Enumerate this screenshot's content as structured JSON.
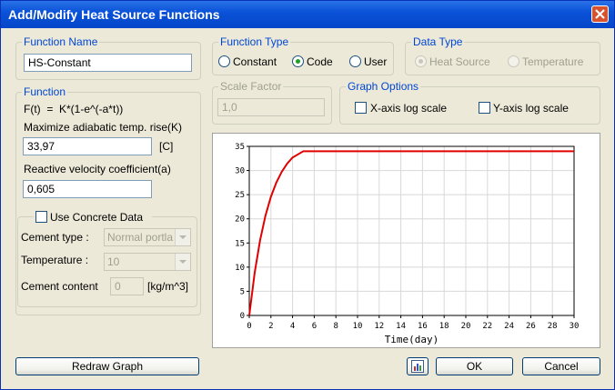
{
  "window": {
    "title": "Add/Modify Heat Source Functions"
  },
  "function_name": {
    "label": "Function Name",
    "value": "HS-Constant"
  },
  "function": {
    "label": "Function",
    "formula": "F(t)  =  K*(1-e^(-a*t))",
    "max_temp_label": "Maximize adiabatic temp. rise(K)",
    "max_temp_value": "33,97",
    "max_temp_unit": "[C]",
    "velocity_label": "Reactive velocity coefficient(a)",
    "velocity_value": "0,605"
  },
  "concrete": {
    "use_label": "Use Concrete Data",
    "use_checked": false,
    "cement_type_label": "Cement type :",
    "cement_type_value": "Normal portla",
    "temperature_label": "Temperature :",
    "temperature_value": "10",
    "cement_content_label": "Cement content",
    "cement_content_value": "0",
    "cement_content_unit": "[kg/m^3]"
  },
  "function_type": {
    "label": "Function Type",
    "options": [
      "Constant",
      "Code",
      "User"
    ],
    "selected": "Code"
  },
  "data_type": {
    "label": "Data Type",
    "options": [
      "Heat Source",
      "Temperature"
    ],
    "selected": "Heat Source"
  },
  "scale_factor": {
    "label": "Scale Factor",
    "value": "1,0"
  },
  "graph_options": {
    "label": "Graph Options",
    "x_log_label": "X-axis log scale",
    "y_log_label": "Y-axis log scale",
    "x_log": false,
    "y_log": false
  },
  "buttons": {
    "redraw": "Redraw Graph",
    "ok": "OK",
    "cancel": "Cancel"
  },
  "colors": {
    "accent": "#0046d5",
    "curve": "#e00000",
    "title_bar": "#0a52d8"
  },
  "chart_data": {
    "type": "line",
    "xlabel": "Time(day)",
    "ylabel": "",
    "xlim": [
      0,
      30
    ],
    "ylim": [
      0,
      35
    ],
    "xticks": [
      0,
      2,
      4,
      6,
      8,
      10,
      12,
      14,
      16,
      18,
      20,
      22,
      24,
      26,
      28,
      30
    ],
    "yticks": [
      0,
      5,
      10,
      15,
      20,
      25,
      30,
      35
    ],
    "grid": true,
    "series": [
      {
        "x": [
          0,
          0.5,
          1,
          1.5,
          2,
          2.5,
          3,
          3.5,
          4,
          5,
          6,
          7,
          8,
          10,
          12,
          15,
          20,
          25,
          30
        ],
        "values": [
          0,
          8.87,
          15.59,
          20.71,
          24.58,
          27.51,
          29.74,
          31.43,
          32.7,
          34.0,
          34.0,
          34.0,
          34.0,
          34.0,
          34.0,
          34.0,
          34.0,
          34.0,
          34.0
        ]
      }
    ]
  }
}
